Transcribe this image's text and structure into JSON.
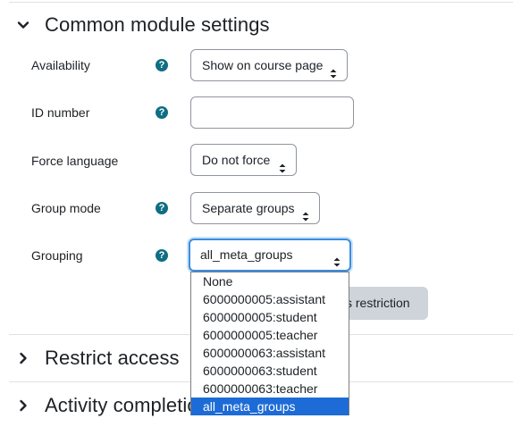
{
  "sections": {
    "common": {
      "title": "Common module settings"
    },
    "restrict": {
      "title": "Restrict access"
    },
    "completion": {
      "title": "Activity completion"
    }
  },
  "fields": {
    "availability": {
      "label": "Availability",
      "value": "Show on course page"
    },
    "id_number": {
      "label": "ID number",
      "value": ""
    },
    "force_language": {
      "label": "Force language",
      "value": "Do not force"
    },
    "group_mode": {
      "label": "Group mode",
      "value": "Separate groups"
    },
    "grouping": {
      "label": "Grouping",
      "value": "all_meta_groups"
    }
  },
  "help_icon_glyph": "?",
  "restriction_button": {
    "label": "s restriction"
  },
  "grouping_options": [
    "None",
    "6000000005:assistant",
    "6000000005:student",
    "6000000005:teacher",
    "6000000063:assistant",
    "6000000063:student",
    "6000000063:teacher",
    "all_meta_groups"
  ],
  "grouping_selected_index": 7,
  "colors": {
    "help_icon": "#0f6e84",
    "focus_ring": "#3a8de0",
    "selected_option": "#1d6bd6"
  }
}
